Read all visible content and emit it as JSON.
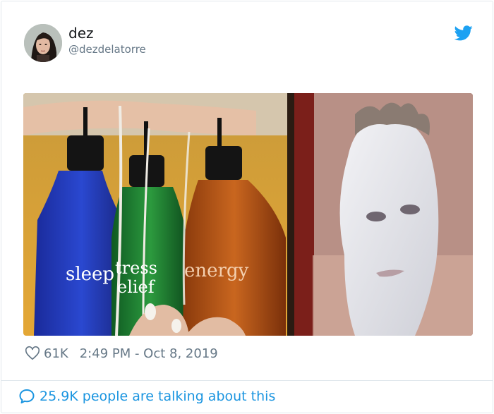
{
  "user": {
    "name": "dez",
    "handle": "@dezdelatorre"
  },
  "icons": {
    "brand": "twitter-bird-icon",
    "like": "heart-outline-icon",
    "conversation": "speech-bubble-icon"
  },
  "colors": {
    "brand": "#1da1f2",
    "link": "#1b95e0",
    "muted": "#657786"
  },
  "media": {
    "labels": {
      "left_bottle": "sleep",
      "middle_bottle_top": "tress",
      "middle_bottle_bottom": "elief",
      "right_bottle": "energy"
    }
  },
  "tweet": {
    "likes": "61K",
    "timestamp": "2:49 PM - Oct 8, 2019"
  },
  "footer": {
    "talking": "25.9K people are talking about this"
  }
}
